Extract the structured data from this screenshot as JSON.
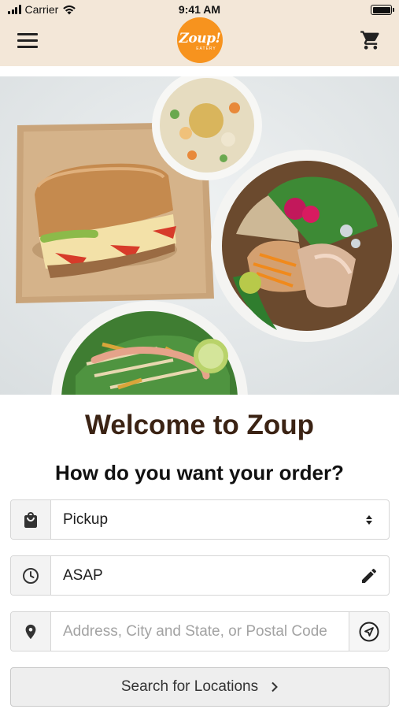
{
  "status_bar": {
    "carrier": "Carrier",
    "time": "9:41 AM"
  },
  "header": {
    "logo": {
      "main": "Zoup!",
      "sub": "EATERY",
      "color": "#f7931e"
    },
    "menu_icon": "hamburger-menu-icon",
    "cart_icon": "shopping-cart-icon",
    "background": "#f3e7d8"
  },
  "hero": {
    "image_alt": "Food spread: sandwich, soup, grain bowl and salad"
  },
  "welcome": {
    "title": "Welcome to Zoup",
    "question": "How do you want your order?"
  },
  "order_form": {
    "order_type": {
      "icon": "shopping-bag-icon",
      "value": "Pickup",
      "options": [
        "Pickup"
      ],
      "suffix_icon": "sort-arrows-icon"
    },
    "time": {
      "icon": "clock-icon",
      "value": "ASAP",
      "suffix_icon": "pencil-edit-icon"
    },
    "address": {
      "icon": "location-pin-icon",
      "placeholder": "Address, City and State, or Postal Code",
      "value": "",
      "suffix_icon": "navigation-arrow-icon"
    },
    "search_button": {
      "label": "Search for Locations",
      "icon": "chevron-right-icon"
    }
  },
  "colors": {
    "brand_orange": "#f7931e",
    "title_brown": "#3b2314",
    "header_bg": "#f3e7d8"
  }
}
